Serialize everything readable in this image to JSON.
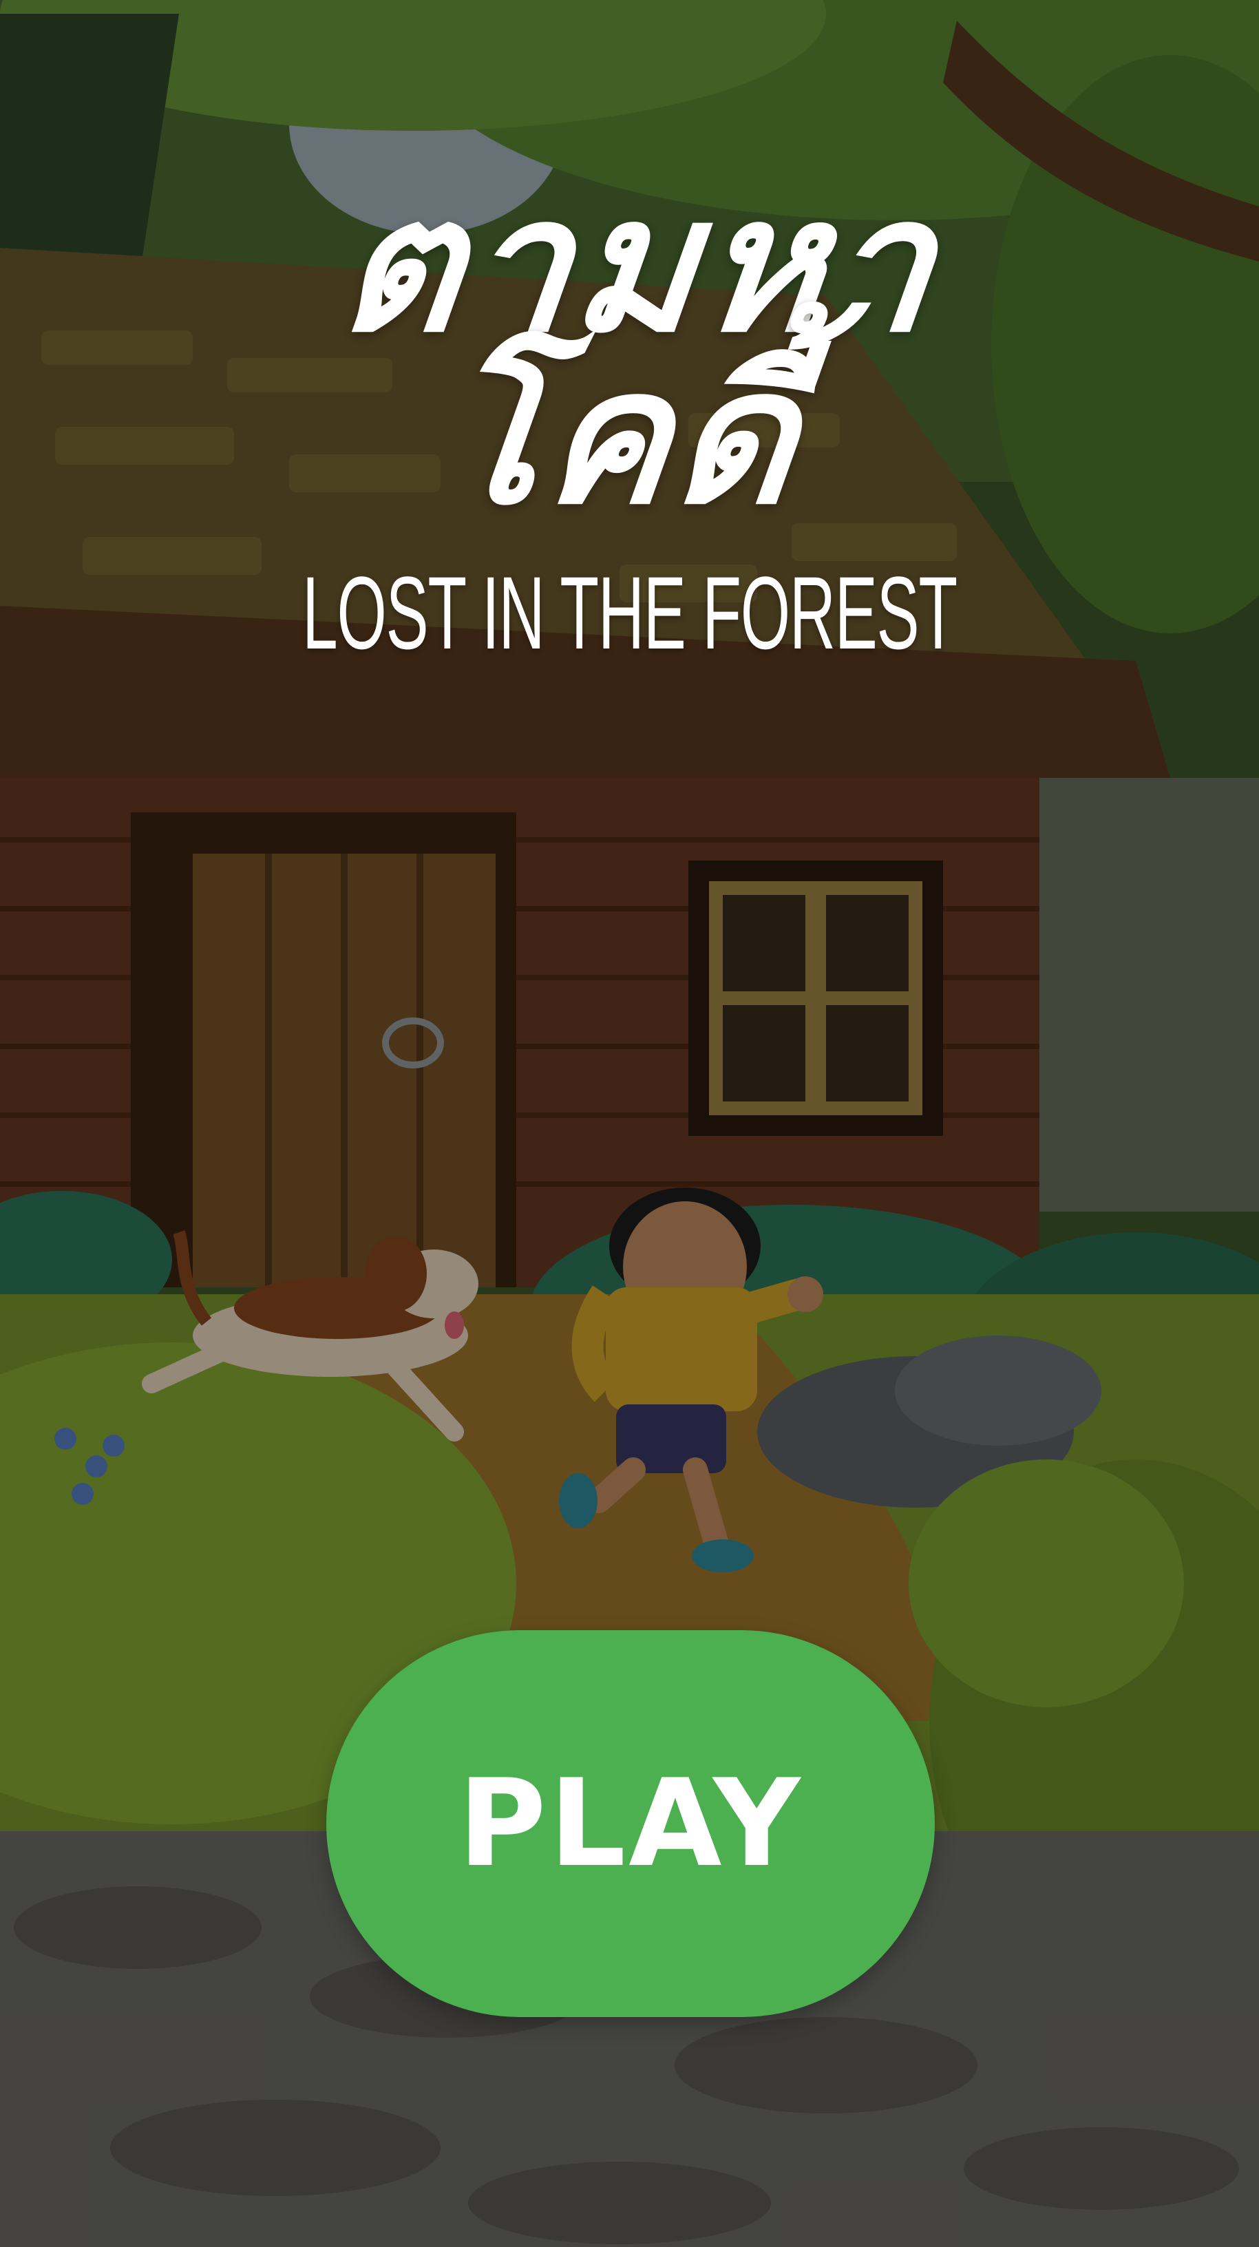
{
  "title": {
    "thai": "ตามหาโคดี้",
    "english": "LOST IN THE FOREST"
  },
  "play_button": {
    "label": "PLAY"
  },
  "colors": {
    "play_button": "#4caf50",
    "title_text": "#ffffff"
  }
}
